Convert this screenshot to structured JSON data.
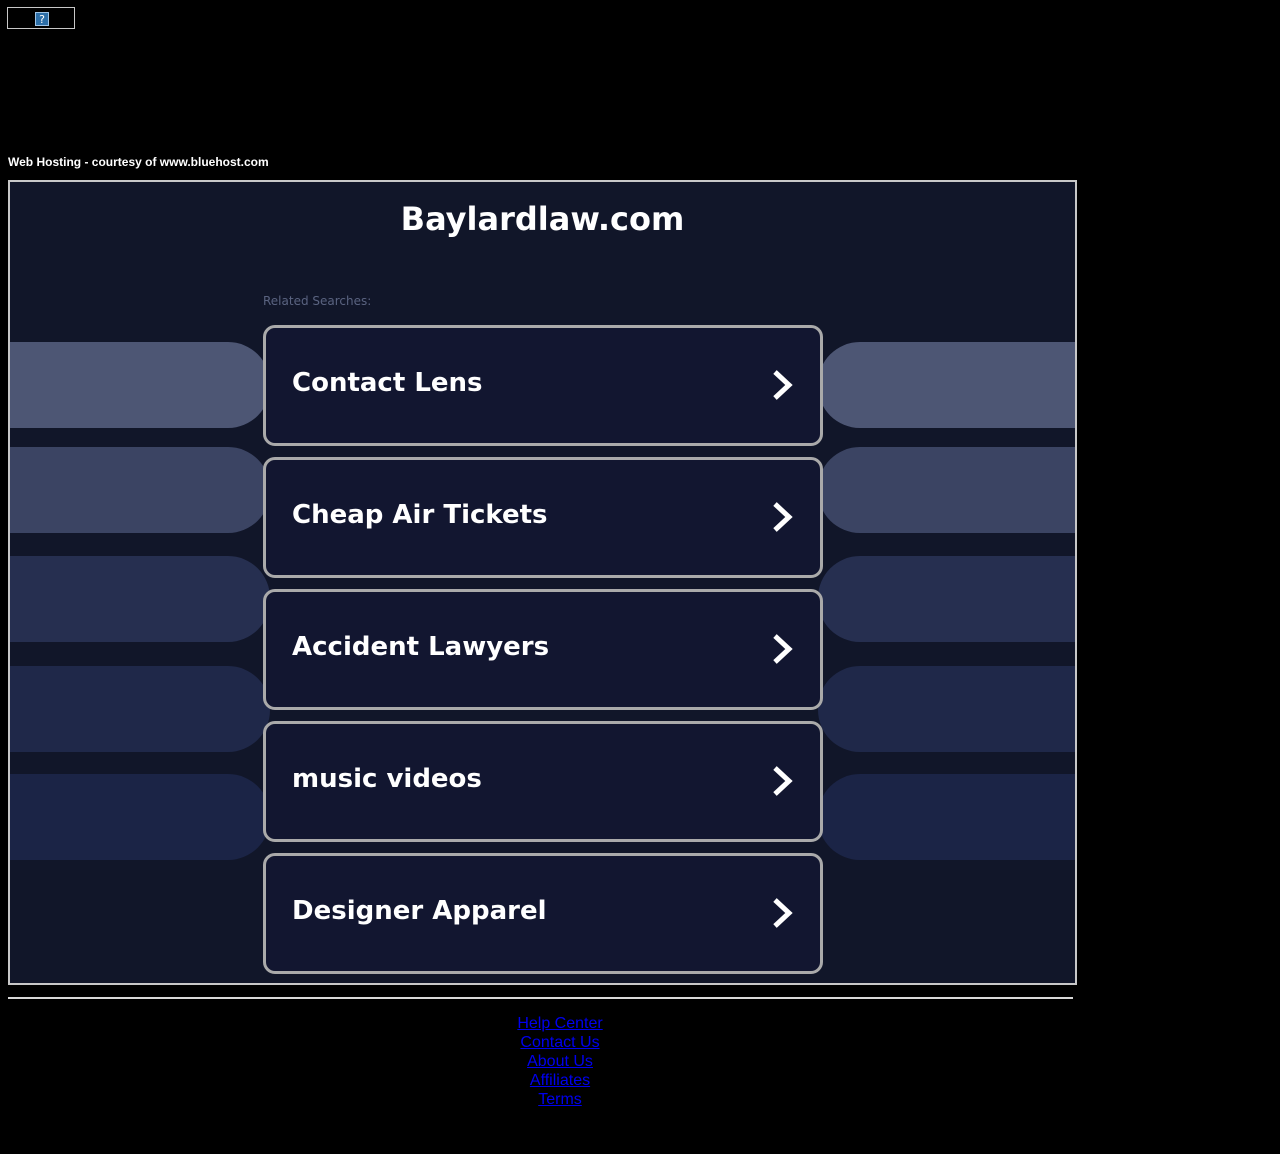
{
  "banner": {
    "icon": "broken-image-icon",
    "icon_glyph": "?"
  },
  "hosting_note": "Web Hosting - courtesy of www.bluehost.com",
  "domain_title": "Baylardlaw.com",
  "related_label": "Related Searches:",
  "results": [
    {
      "label": "Contact Lens",
      "icon": "chevron-right-icon"
    },
    {
      "label": "Cheap Air Tickets",
      "icon": "chevron-right-icon"
    },
    {
      "label": "Accident Lawyers",
      "icon": "chevron-right-icon"
    },
    {
      "label": "music videos",
      "icon": "chevron-right-icon"
    },
    {
      "label": "Designer Apparel",
      "icon": "chevron-right-icon"
    }
  ],
  "side_pill_colors": [
    "#4d5674",
    "#3b4463",
    "#262f50",
    "#1f2849",
    "#1b2446"
  ],
  "colors": {
    "page_background": "#000000",
    "panel_background": "#111629",
    "card_background": "#121630",
    "card_border": "#aaaaaa",
    "link": "#0000ee"
  },
  "footer": {
    "links": [
      "Help Center",
      "Contact Us",
      "About Us",
      "Affiliates",
      "Terms"
    ]
  }
}
